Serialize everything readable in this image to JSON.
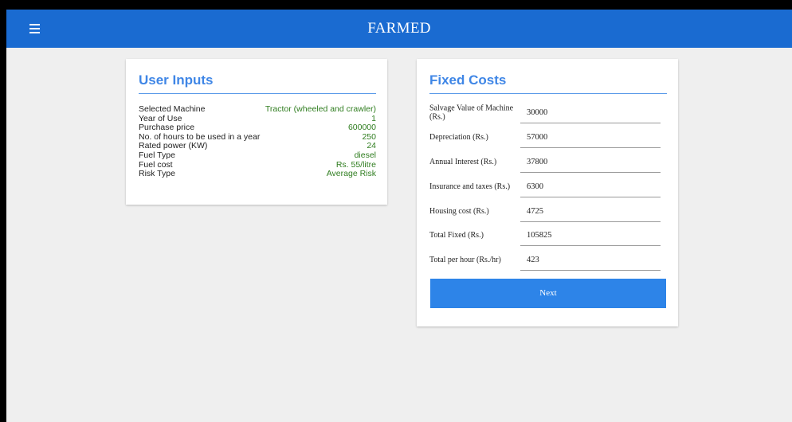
{
  "app": {
    "title": "FARMED",
    "menu_icon": "hamburger-menu-icon",
    "colors": {
      "appbar": "#1a6bd1",
      "accent": "#3f86e6",
      "value_green": "#2f7d1f",
      "button": "#2d84e8"
    }
  },
  "user_inputs": {
    "title": "User Inputs",
    "rows": [
      {
        "label": "Selected Machine",
        "value": "Tractor (wheeled and crawler)"
      },
      {
        "label": "Year of Use",
        "value": "1"
      },
      {
        "label": "Purchase price",
        "value": "600000"
      },
      {
        "label": "No. of hours to be used in a year",
        "value": "250"
      },
      {
        "label": "Rated power (KW)",
        "value": "24"
      },
      {
        "label": "Fuel Type",
        "value": "diesel"
      },
      {
        "label": "Fuel cost",
        "value": "Rs. 55/litre"
      },
      {
        "label": "Risk Type",
        "value": "Average Risk"
      }
    ]
  },
  "fixed_costs": {
    "title": "Fixed Costs",
    "rows": [
      {
        "label": "Salvage Value of Machine (Rs.)",
        "value": "30000"
      },
      {
        "label": "Depreciation (Rs.)",
        "value": "57000"
      },
      {
        "label": "Annual Interest (Rs.)",
        "value": "37800"
      },
      {
        "label": "Insurance and taxes (Rs.)",
        "value": "6300"
      },
      {
        "label": "Housing cost (Rs.)",
        "value": "4725"
      },
      {
        "label": "Total Fixed (Rs.)",
        "value": "105825"
      },
      {
        "label": "Total per hour (Rs./hr)",
        "value": "423"
      }
    ],
    "next_label": "Next"
  }
}
